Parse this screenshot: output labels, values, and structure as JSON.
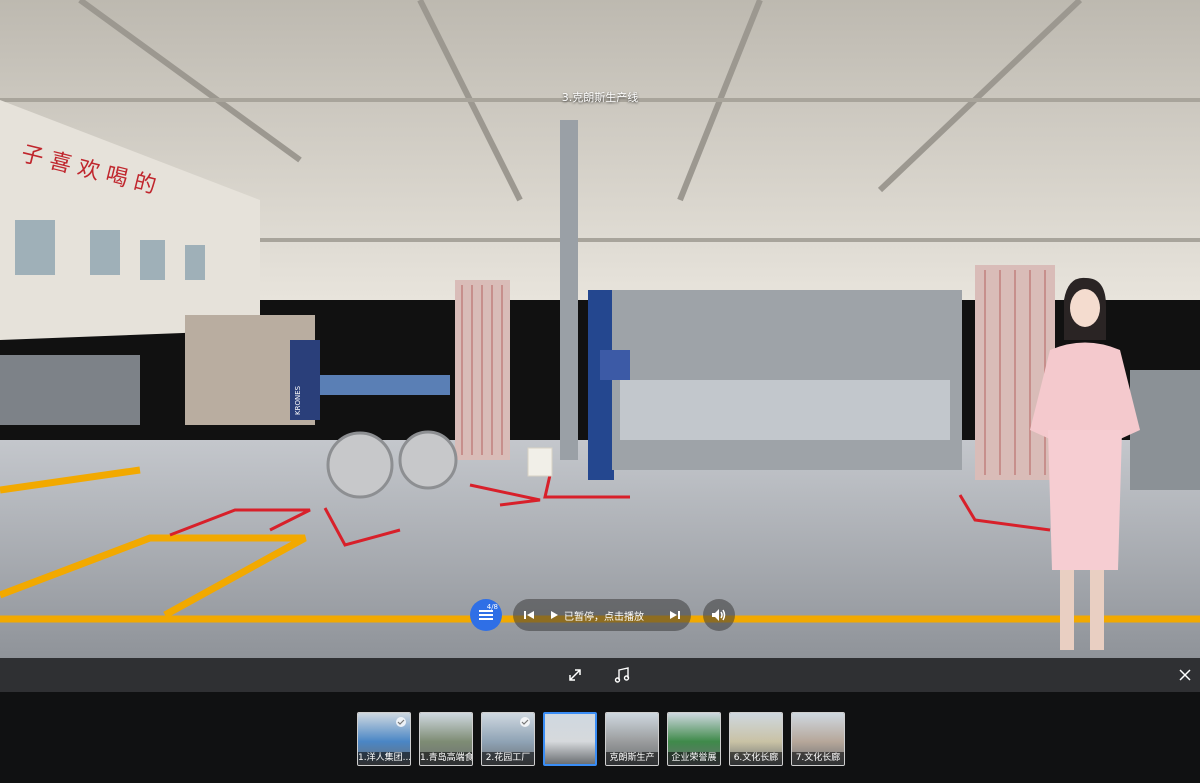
{
  "scene": {
    "title": "3.克朗斯生产线",
    "wall_banner": "子   喜 欢 喝 的",
    "machine_brand": "KRONES"
  },
  "controls": {
    "list_count": "4/8",
    "player_status": "已暂停，点击播放",
    "accent": "#2f6fe6"
  },
  "thumbnails": [
    {
      "label": "1.洋人集团...",
      "checked": true,
      "color": "#4a86c5"
    },
    {
      "label": "1.青岛高端食",
      "checked": false,
      "color": "#7e8c74"
    },
    {
      "label": "2.花园工厂",
      "checked": true,
      "color": "#8fa3b5"
    },
    {
      "label": "",
      "checked": false,
      "active": true,
      "color": "#d6d9dc"
    },
    {
      "label": "克朗斯生产",
      "checked": false,
      "color": "#9a9c9d"
    },
    {
      "label": "企业荣誉展",
      "checked": false,
      "color": "#3f8a4a"
    },
    {
      "label": "6.文化长廊",
      "checked": false,
      "color": "#c9c2a5"
    },
    {
      "label": "7.文化长廊",
      "checked": false,
      "color": "#b6a79a"
    }
  ]
}
